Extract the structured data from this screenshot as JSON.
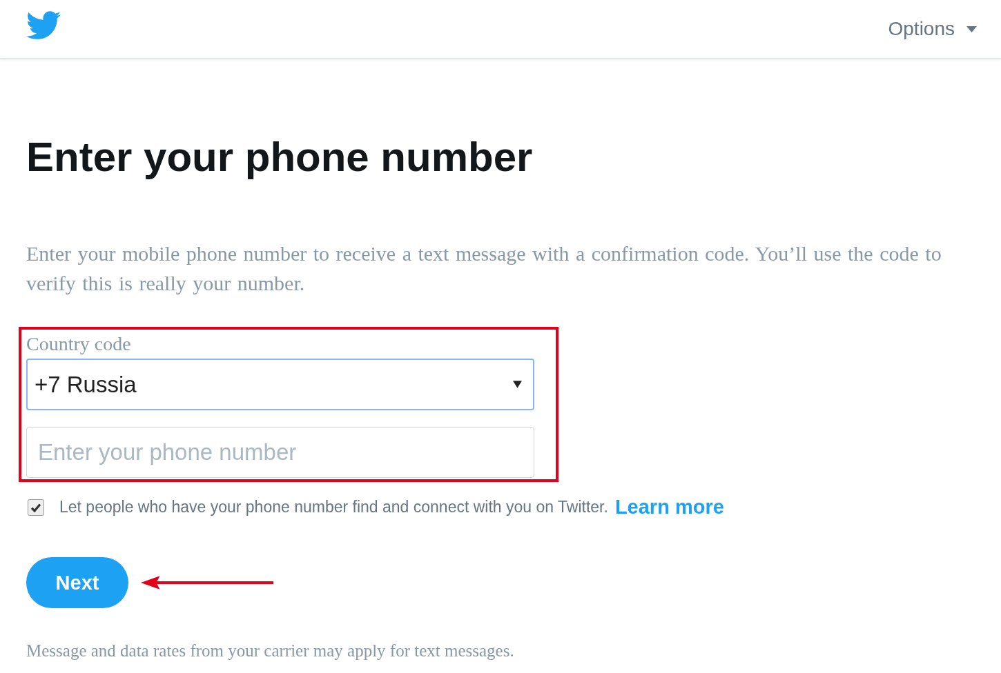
{
  "header": {
    "options_label": "Options"
  },
  "title": "Enter your phone number",
  "description": "Enter your mobile phone number to receive a text message with a confirmation code. You’ll use the code to verify this is really your number.",
  "country_code": {
    "label": "Country code",
    "value": "+7 Russia"
  },
  "phone": {
    "placeholder": "Enter your phone number"
  },
  "discoverable": {
    "checked": true,
    "label": "Let people who have your phone number find and connect with you on Twitter.",
    "link": "Learn more"
  },
  "next_button": "Next",
  "footer_note": "Message and data rates from your carrier may apply for text messages."
}
